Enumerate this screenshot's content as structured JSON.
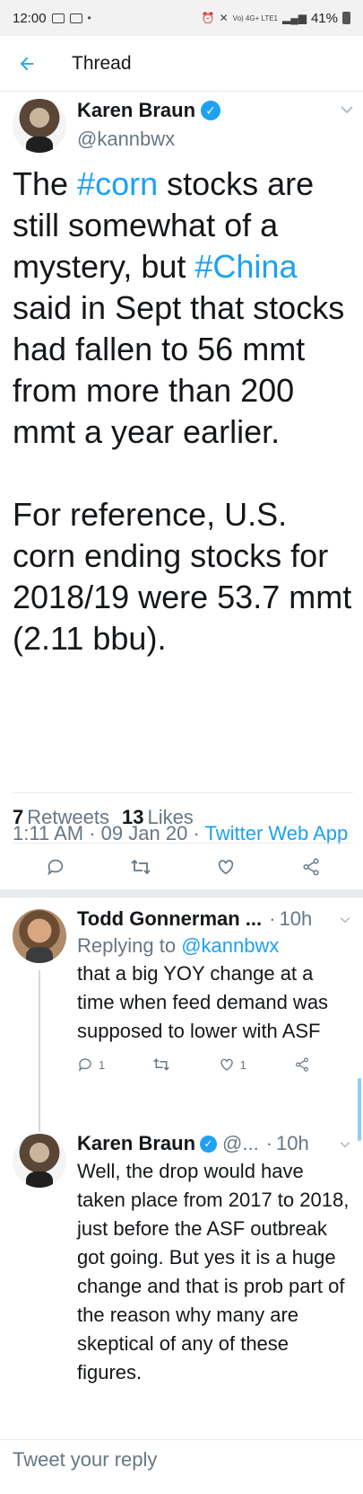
{
  "status_bar": {
    "time": "12:00",
    "network": "Vo) 4G+ LTE1",
    "battery": "41%"
  },
  "app_bar": {
    "title": "Thread"
  },
  "main_tweet": {
    "author_name": "Karen Braun",
    "author_handle": "@kannbwx",
    "text_segments": {
      "p1_a": "The ",
      "p1_tag1": "#corn",
      "p1_b": " stocks are still somewhat of a mystery, but ",
      "p1_tag2": "#China",
      "p1_c": " said in Sept that stocks had fallen to 56 mmt from more than 200 mmt a year earlier.",
      "p2": "For reference, U.S. corn ending stocks for 2018/19 were 53.7 mmt (2.11 bbu)."
    },
    "time": "1:11 AM",
    "date": "09 Jan 20",
    "source": "Twitter Web App",
    "retweets_count": "7",
    "retweets_label": "Retweets",
    "likes_count": "13",
    "likes_label": "Likes"
  },
  "replies": [
    {
      "name": "Todd Gonnerman ...",
      "handle": "",
      "time": "10h",
      "replying_prefix": "Replying to ",
      "replying_to": "@kannbwx",
      "text": "that a big YOY change at a time when feed demand was supposed to lower with ASF",
      "reply_count": "1",
      "like_count": "1"
    },
    {
      "name": "Karen Braun",
      "handle": "@...",
      "time": "10h",
      "text": "Well, the drop would have taken place from 2017 to 2018, just before the ASF outbreak got going. But yes it is a huge change and that is prob part of the reason why many are skeptical of any of these figures."
    }
  ],
  "compose": {
    "placeholder": "Tweet your reply"
  },
  "colors": {
    "accent": "#1da1f2",
    "secondary_text": "#657786",
    "primary_text": "#14171a"
  }
}
